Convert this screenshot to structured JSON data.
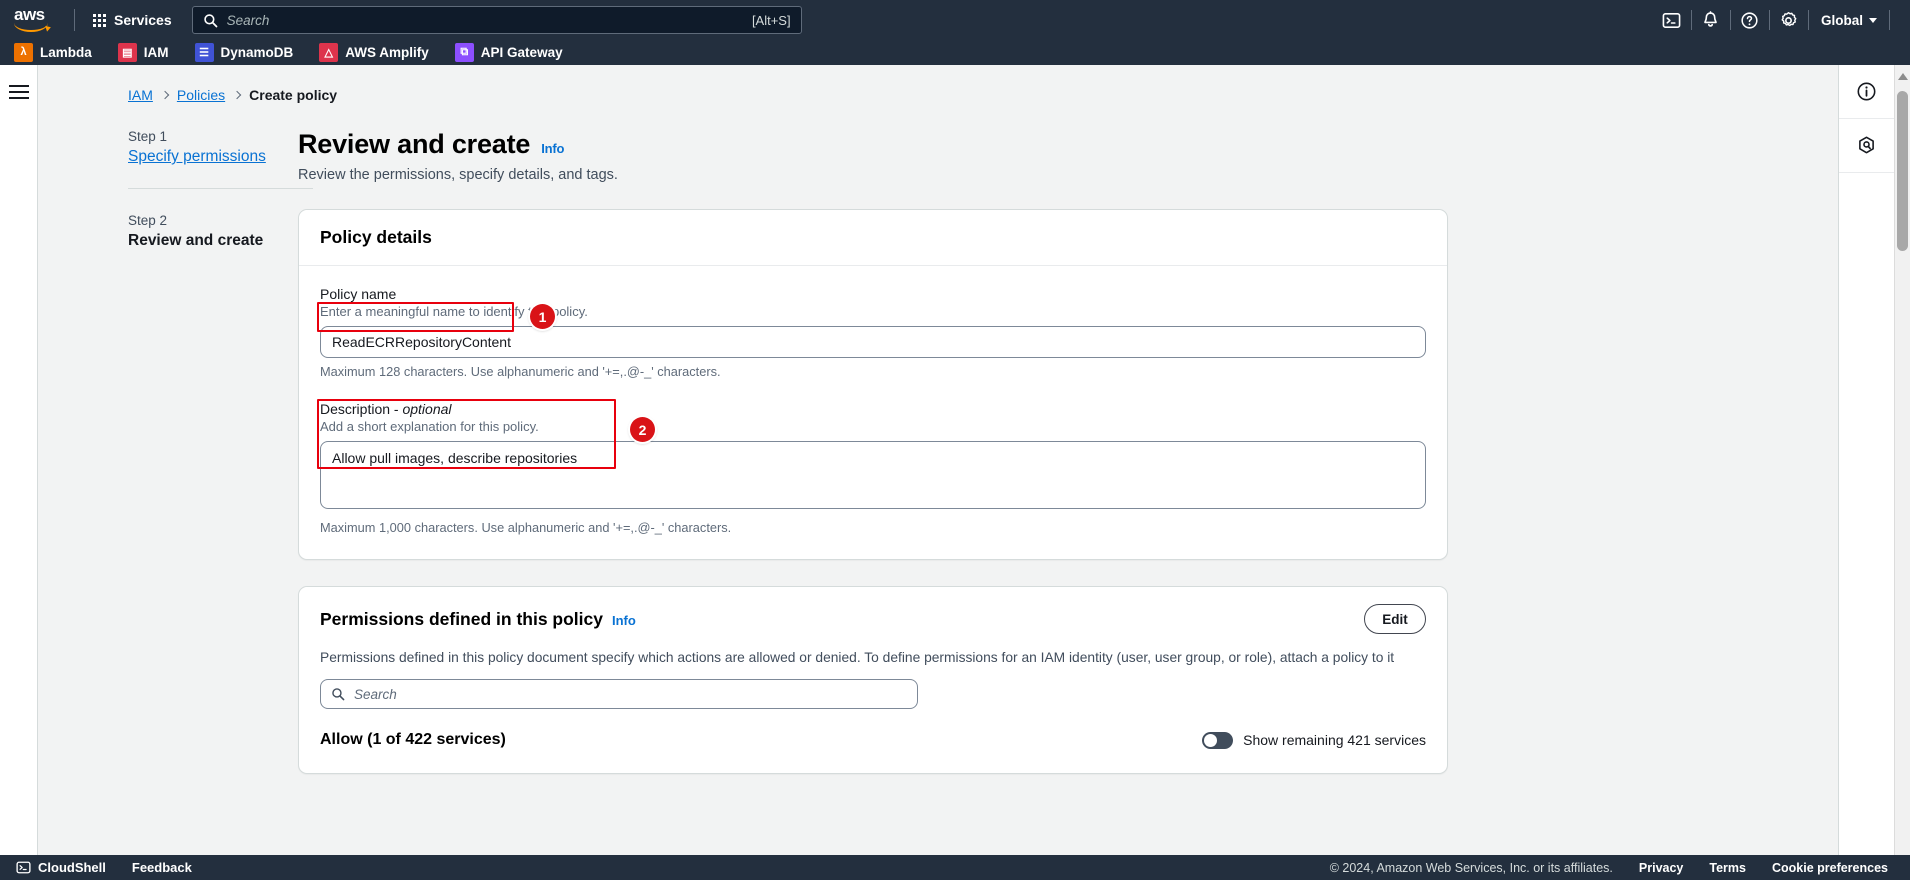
{
  "topnav": {
    "logo_text": "aws",
    "services_label": "Services",
    "search_placeholder": "Search",
    "search_shortcut": "[Alt+S]",
    "icons": [
      "cloudshell-icon",
      "notifications-bell-icon",
      "help-question-icon",
      "settings-gear-icon"
    ],
    "region_label": "Global"
  },
  "favorites": [
    {
      "label": "Lambda",
      "icon": "lambda-service-icon",
      "color": "#ed7100",
      "glyph": "λ"
    },
    {
      "label": "IAM",
      "icon": "iam-service-icon",
      "color": "#dd344c",
      "glyph": "▤"
    },
    {
      "label": "DynamoDB",
      "icon": "dynamodb-service-icon",
      "color": "#4053d6",
      "glyph": "≣"
    },
    {
      "label": "AWS Amplify",
      "icon": "amplify-service-icon",
      "color": "#dd344c",
      "glyph": "△"
    },
    {
      "label": "API Gateway",
      "icon": "apigateway-service-icon",
      "color": "#8c4fff",
      "glyph": "⧉"
    }
  ],
  "breadcrumb": {
    "items": [
      "IAM",
      "Policies",
      "Create policy"
    ]
  },
  "steps": [
    {
      "number": "Step 1",
      "label": "Specify permissions",
      "current": false
    },
    {
      "number": "Step 2",
      "label": "Review and create",
      "current": true
    }
  ],
  "page": {
    "title": "Review and create",
    "info_label": "Info",
    "subtitle": "Review the permissions, specify details, and tags."
  },
  "policy_details": {
    "card_title": "Policy details",
    "name_label": "Policy name",
    "name_help": "Enter a meaningful name to identify this policy.",
    "name_value": "ReadECRRepositoryContent",
    "name_hint": "Maximum 128 characters. Use alphanumeric and '+=,.@-_' characters.",
    "desc_label": "Description - ",
    "desc_label_optional": "optional",
    "desc_help": "Add a short explanation for this policy.",
    "desc_value": "Allow pull images, describe repositories",
    "desc_hint": "Maximum 1,000 characters. Use alphanumeric and '+=,.@-_' characters."
  },
  "permissions": {
    "card_title": "Permissions defined in this policy",
    "info_label": "Info",
    "edit_label": "Edit",
    "description": "Permissions defined in this policy document specify which actions are allowed or denied. To define permissions for an IAM identity (user, user group, or role), attach a policy to it",
    "search_placeholder": "Search",
    "allow_label": "Allow (1 of 422 services)",
    "toggle_label": "Show remaining 421 services",
    "toggle_on": false
  },
  "annotations": [
    {
      "badge": "1",
      "target": "policy-name-input"
    },
    {
      "badge": "2",
      "target": "policy-description-textarea"
    }
  ],
  "right_rail": {
    "items": [
      "info-panel-icon",
      "shortcuts-hexagon-icon"
    ]
  },
  "footer": {
    "cloudshell_label": "CloudShell",
    "feedback_label": "Feedback",
    "copyright": "© 2024, Amazon Web Services, Inc. or its affiliates.",
    "links": [
      "Privacy",
      "Terms",
      "Cookie preferences"
    ]
  },
  "colors": {
    "nav_bg": "#232f3e",
    "link_blue": "#0972d3",
    "annotation_red": "#d91317",
    "page_bg": "#f2f3f3"
  }
}
